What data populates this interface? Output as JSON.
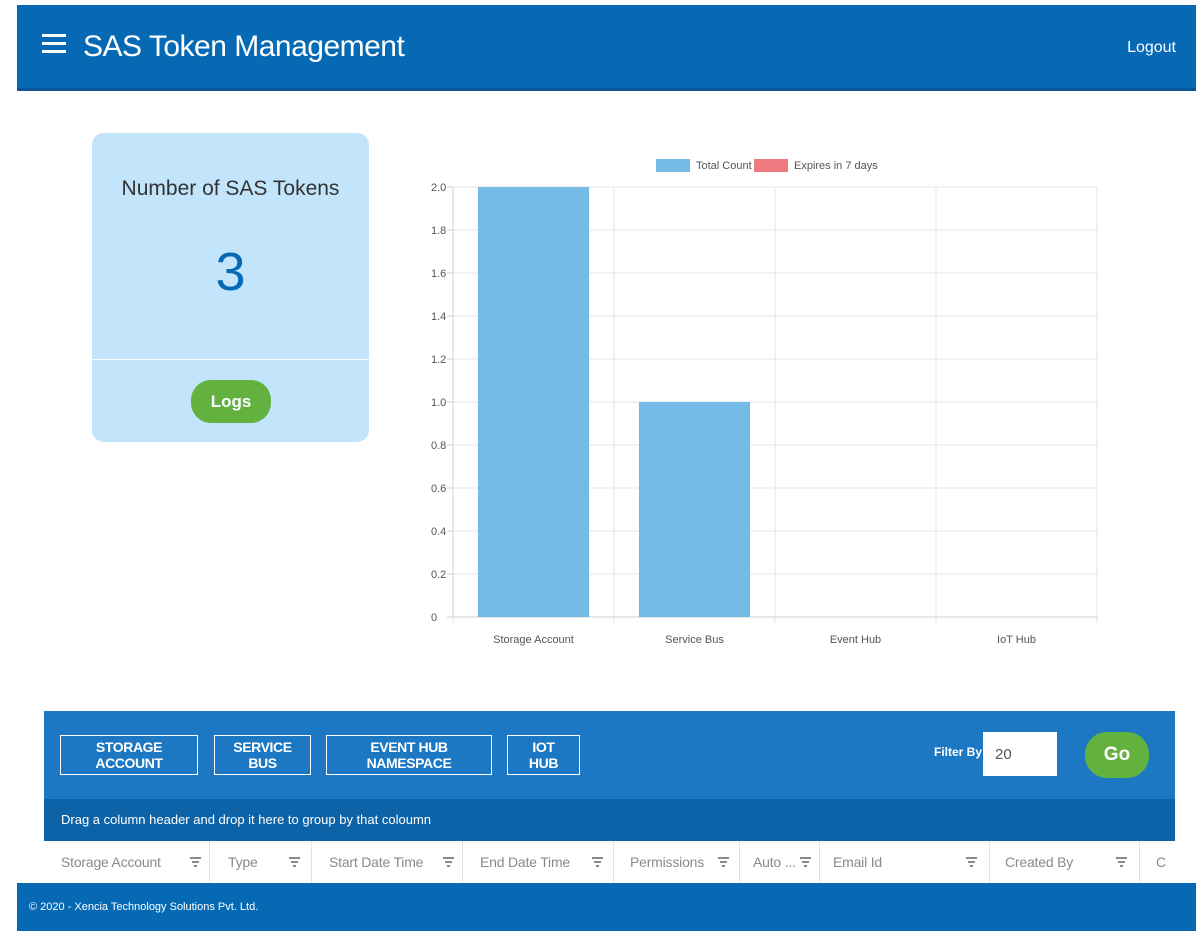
{
  "header": {
    "title": "SAS Token Management",
    "logout_label": "Logout"
  },
  "token_card": {
    "title": "Number of SAS Tokens",
    "count": "3",
    "logs_label": "Logs"
  },
  "chart_data": {
    "type": "bar",
    "categories": [
      "Storage Account",
      "Service Bus",
      "Event Hub",
      "IoT Hub"
    ],
    "series": [
      {
        "name": "Total Count",
        "values": [
          2,
          1,
          0,
          0
        ],
        "color": "#74bbe8"
      },
      {
        "name": "Expires in 7 days",
        "values": [
          0,
          0,
          0,
          0
        ],
        "color": "#ef7b80"
      }
    ],
    "y_ticks": [
      "0",
      "0.2",
      "0.4",
      "0.6",
      "0.8",
      "1.0",
      "1.2",
      "1.4",
      "1.6",
      "1.8",
      "2.0"
    ],
    "ylim": [
      0,
      2
    ],
    "grid": true,
    "legend_position": "top-center",
    "xlabel": "",
    "ylabel": ""
  },
  "toolbar": {
    "buttons": [
      "STORAGE ACCOUNT",
      "SERVICE BUS",
      "EVENT HUB NAMESPACE",
      "IOT HUB"
    ],
    "filter_label": "Filter By:",
    "filter_value": "20",
    "go_label": "Go"
  },
  "grid": {
    "group_hint": "Drag a column header and drop it here to group by that coloumn",
    "columns": [
      "Storage Account",
      "Type",
      "Start Date Time",
      "End Date Time",
      "Permissions",
      "Auto ...",
      "Email Id",
      "Created By",
      "C"
    ]
  },
  "footer": {
    "copyright": "© 2020 - Xencia Technology Solutions Pvt. Ltd."
  },
  "icons": {
    "menu": "menu-icon",
    "column_filter": "filter-icon"
  },
  "colors": {
    "header_bg": "#0569b4",
    "card_bg": "#c2e5fb",
    "accent_green": "#63b13f",
    "panel_bg": "#1c78c2",
    "group_bar_bg": "#0c63a8"
  }
}
